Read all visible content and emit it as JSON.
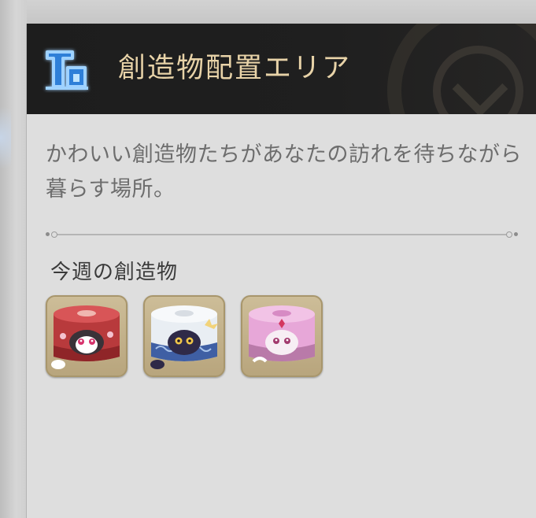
{
  "header": {
    "title": "創造物配置エリア",
    "icon": "area-house-icon",
    "icon_color": "#5fb3ff"
  },
  "description": "かわいい創造物たちがあなたの訪れを待ちながら暮らす場所。",
  "section": {
    "title": "今週の創造物"
  },
  "creatures": [
    {
      "name": "creature-red-cat-box-icon",
      "color": "#b83a3c"
    },
    {
      "name": "creature-white-cat-box-icon",
      "color": "#e9eef3"
    },
    {
      "name": "creature-pink-cat-box-icon",
      "color": "#e7a7d8"
    }
  ],
  "colors": {
    "header_bg": "#1f1f1f",
    "title_gold": "#e8d3a8",
    "panel_bg": "#dedede",
    "slot_bg": "#c4b38c"
  }
}
